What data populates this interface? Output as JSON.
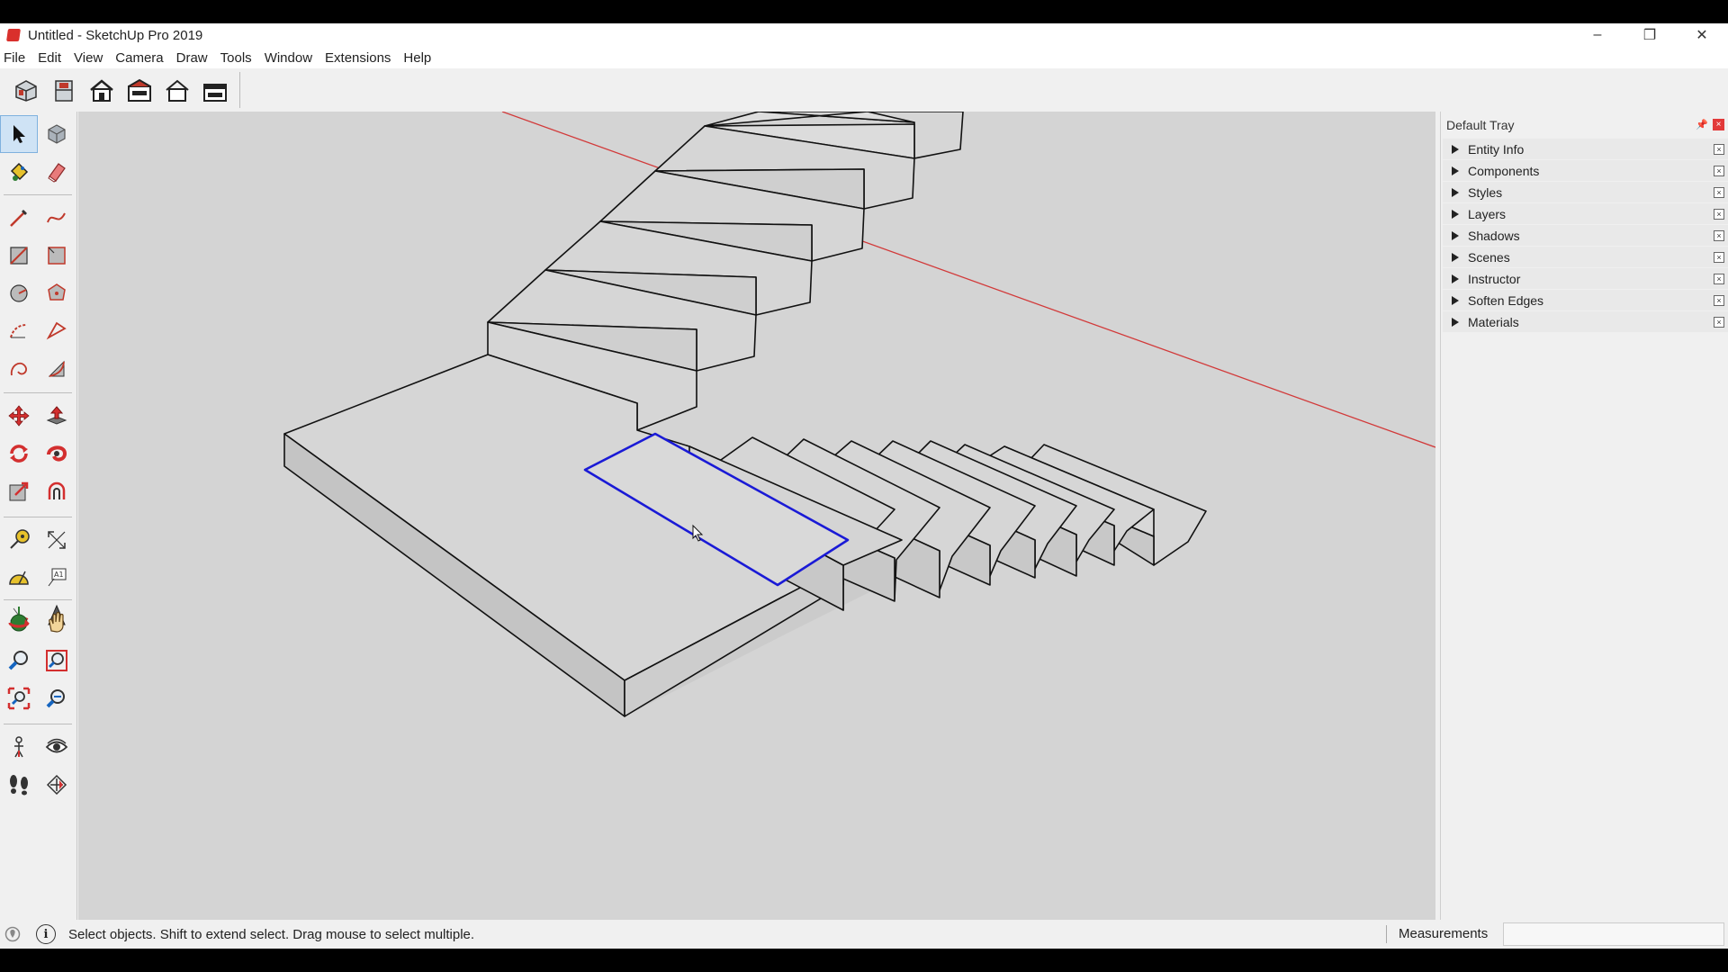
{
  "window": {
    "title": "Untitled - SketchUp Pro 2019",
    "controls": [
      "–",
      "❐",
      "✕"
    ]
  },
  "menu": [
    "File",
    "Edit",
    "View",
    "Camera",
    "Draw",
    "Tools",
    "Window",
    "Extensions",
    "Help"
  ],
  "toolbar": {
    "views": [
      "iso-view-icon",
      "top-view-icon",
      "front-view-icon",
      "right-view-icon",
      "back-view-icon",
      "left-view-icon"
    ]
  },
  "palette": {
    "tools": [
      "select-icon",
      "make-component-icon",
      "paint-bucket-icon",
      "eraser-icon",
      "line-icon",
      "freehand-icon",
      "rectangle-icon",
      "rotated-rectangle-icon",
      "circle-icon",
      "polygon-icon",
      "arc-icon",
      "two-point-arc-icon",
      "three-point-arc-icon",
      "pie-icon",
      "move-icon",
      "push-pull-icon",
      "rotate-icon",
      "follow-me-icon",
      "scale-icon",
      "offset-icon",
      "tape-measure-icon",
      "dimension-icon",
      "protractor-icon",
      "text-icon",
      "axes-icon",
      "3d-text-icon",
      "orbit-icon",
      "pan-icon",
      "zoom-icon",
      "zoom-window-icon",
      "zoom-extents-icon",
      "previous-view-icon",
      "position-camera-icon",
      "look-around-icon",
      "walk-icon",
      "section-plane-icon"
    ]
  },
  "tray": {
    "title": "Default Tray",
    "panels": [
      "Entity Info",
      "Components",
      "Styles",
      "Layers",
      "Shadows",
      "Scenes",
      "Instructor",
      "Soften Edges",
      "Materials"
    ]
  },
  "status": {
    "message": "Select objects. Shift to extend select. Drag mouse to select multiple.",
    "info_symbol": "i",
    "measurements_label": "Measurements",
    "measurements_value": ""
  },
  "colors": {
    "viewport_bg": "#d4d4d4",
    "red_axis": "#d23a3a",
    "selection": "#1a1ad6",
    "edge": "#111111"
  }
}
